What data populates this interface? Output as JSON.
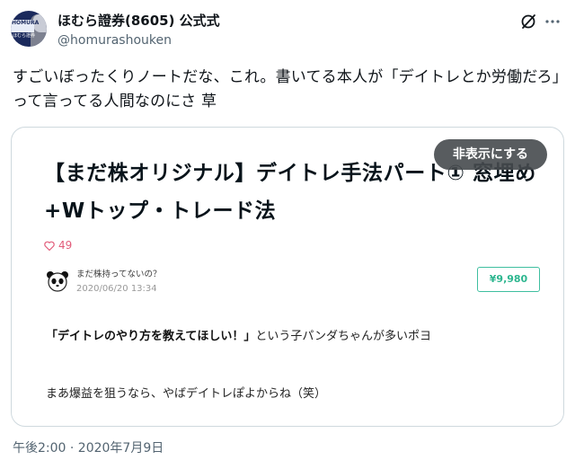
{
  "tweet": {
    "author": {
      "display_name": "ほむら證券(8605) 公式式",
      "handle": "@homurashouken",
      "avatar_brand": "HOMURA",
      "avatar_sub": "ほむら證券"
    },
    "text": "すごいぼったくりノートだな、これ。書いてる本人が「デイトレとか労働だろ」って言ってる人間なのにさ 草",
    "timestamp": "午後2:00 · 2020年7月9日"
  },
  "card": {
    "title": "【まだ株オリジナル】デイトレ手法パート① 窓埋め+Wトップ・トレード法",
    "hide_label": "非表示にする",
    "likes": "49",
    "author_name": "まだ株持ってないの？",
    "date": "2020/06/20 13:34",
    "price": "¥9,980",
    "body_quote": "「デイトレのやり方を教えてほしい！」",
    "body_rest": "という子パンダちゃんが多いポヨ",
    "body_line2": "まあ爆益を狙うなら、やばデイトレぽよからね（笑）"
  },
  "colors": {
    "like": "#e25c7a",
    "price": "#2db68f",
    "muted": "#536471"
  },
  "icons": [
    "grok-icon",
    "more-icon",
    "heart-icon",
    "panda-avatar-icon"
  ]
}
